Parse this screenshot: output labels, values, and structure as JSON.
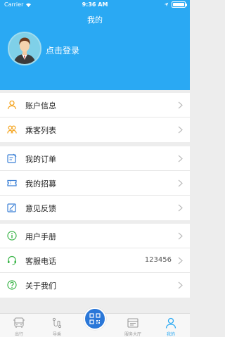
{
  "status_bar": {
    "carrier": "Carrier",
    "time": "9:36 AM"
  },
  "header": {
    "title": "我的",
    "login_text": "点击登录"
  },
  "group1": [
    {
      "label": "账户信息",
      "icon": "person-icon"
    },
    {
      "label": "乘客列表",
      "icon": "passengers-icon"
    }
  ],
  "group2": [
    {
      "label": "我的订单",
      "icon": "order-icon"
    },
    {
      "label": "我的招募",
      "icon": "ticket-icon"
    },
    {
      "label": "意见反馈",
      "icon": "feedback-icon"
    }
  ],
  "group3": [
    {
      "label": "用户手册",
      "icon": "info-icon"
    },
    {
      "label": "客服电话",
      "value": "123456",
      "icon": "headset-icon"
    },
    {
      "label": "关于我们",
      "icon": "question-icon"
    }
  ],
  "tabbar": [
    {
      "label": "出行",
      "icon": "bus-icon"
    },
    {
      "label": "导乘",
      "icon": "route-icon"
    },
    {
      "label": "",
      "icon": "qr-scan-icon"
    },
    {
      "label": "服务大厅",
      "icon": "service-hall-icon"
    },
    {
      "label": "我的",
      "icon": "profile-icon",
      "active": true
    }
  ],
  "colors": {
    "primary": "#2aa9f3",
    "orange": "#f5a623",
    "green": "#3cb54a",
    "blue_icon": "#3a7fd5",
    "qr_button": "#2a77d8"
  }
}
